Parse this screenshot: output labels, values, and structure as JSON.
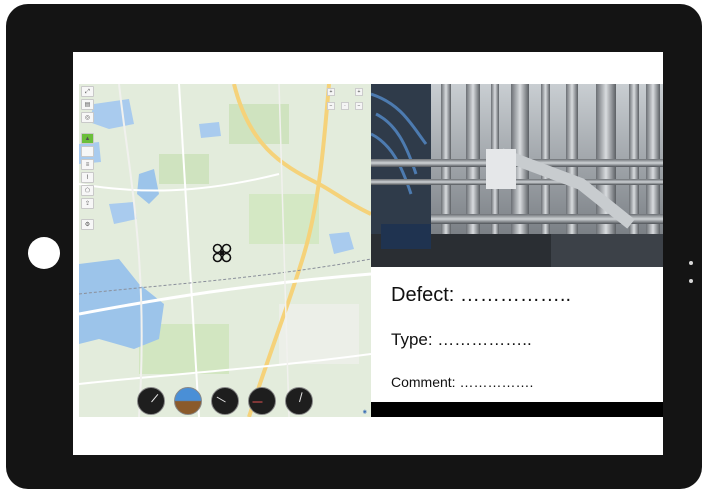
{
  "defect_panel": {
    "defect_line": "Defect: ……………..",
    "type_line": "Type: ……………..",
    "comment_line": "Comment: ……………."
  },
  "icons": {
    "home_button": "home-button",
    "drone": "drone-quadcopter-icon",
    "instruments": [
      "airspeed-gauge-icon",
      "attitude-indicator-icon",
      "altimeter-gauge-icon",
      "vertical-speed-gauge-icon",
      "heading-gauge-icon"
    ]
  },
  "colors": {
    "tablet_frame": "#141414",
    "map_land": "#e3ecdc",
    "map_water": "#9cc4ea",
    "map_road": "#f5d27a",
    "toolbar_active": "#6bbf3a"
  }
}
